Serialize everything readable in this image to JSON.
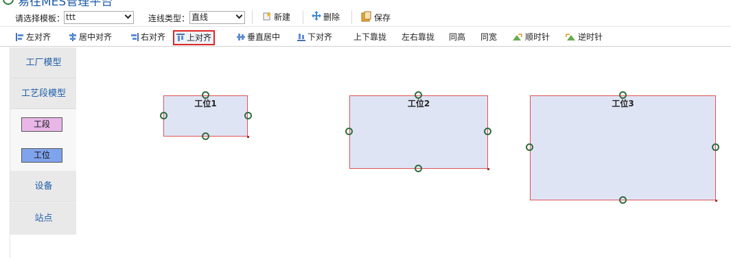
{
  "app": {
    "title": "易往MES管理平台"
  },
  "toolbar1": {
    "template_label": "请选择模板：",
    "template_value": "ttt",
    "line_type_label": "连线类型：",
    "line_type_value": "直线",
    "new_label": "新建",
    "delete_label": "删除",
    "save_label": "保存"
  },
  "toolbar2": {
    "items": [
      {
        "label": "左对齐",
        "icon": "align-left-icon"
      },
      {
        "label": "居中对齐",
        "icon": "align-center-icon"
      },
      {
        "label": "右对齐",
        "icon": "align-right-icon"
      },
      {
        "label": "上对齐",
        "icon": "align-top-icon",
        "active": true
      },
      {
        "label": "垂直居中",
        "icon": "align-middle-icon"
      },
      {
        "label": "下对齐",
        "icon": "align-bottom-icon"
      },
      {
        "label": "上下靠拢"
      },
      {
        "label": "左右靠拢"
      },
      {
        "label": "同高"
      },
      {
        "label": "同宽"
      },
      {
        "label": "顺时针",
        "icon": "rotate-cw-icon"
      },
      {
        "label": "逆时针",
        "icon": "rotate-ccw-icon"
      }
    ]
  },
  "sidebar": {
    "factory_model": "工厂模型",
    "process_model": "工艺段模型",
    "segment": "工段",
    "station": "工位",
    "equipment": "设备",
    "site": "站点"
  },
  "canvas": {
    "stations": [
      {
        "label": "工位1"
      },
      {
        "label": "工位2"
      },
      {
        "label": "工位3"
      }
    ]
  },
  "colors": {
    "segment_fill": "#e8b7e8",
    "station_fill": "#7fa3ec",
    "node_fill": "#dfe4f5",
    "node_border": "#e05050",
    "handle": "#2f6b3a",
    "active_border": "#e02424"
  }
}
